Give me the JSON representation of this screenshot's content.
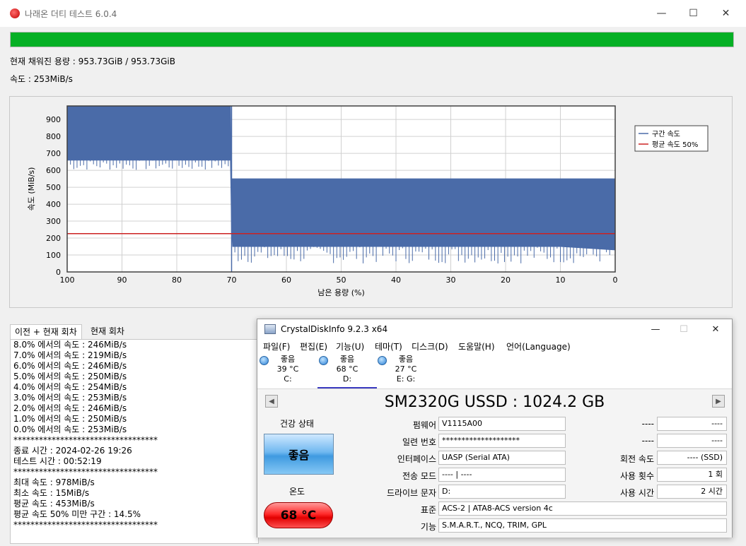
{
  "main_window": {
    "title": "나래온 더티 테스트 6.0.4",
    "progress_percent": 100,
    "filled_label": "현재 채워진 용량 : 953.73GiB / 953.73GiB",
    "speed_label": "속도 : 253MiB/s",
    "minimize_icon": "minimize-icon",
    "maximize_icon": "maximize-icon",
    "close_icon": "close-icon"
  },
  "chart_data": {
    "type": "area",
    "xlabel": "남은 용량 (%)",
    "ylabel": "속도 (MiB/s)",
    "xlim": [
      100,
      0
    ],
    "ylim": [
      0,
      980
    ],
    "x_ticks": [
      "100",
      "90",
      "80",
      "70",
      "60",
      "50",
      "40",
      "30",
      "20",
      "10",
      "0"
    ],
    "y_ticks": [
      "0",
      "100",
      "200",
      "300",
      "400",
      "500",
      "600",
      "700",
      "800",
      "900"
    ],
    "grid": true,
    "legend_position": "top-right",
    "series": [
      {
        "name": "구간 속도",
        "color": "#4a6ba8",
        "x": [
          100,
          90,
          80,
          70.2,
          70,
          69.8,
          60,
          50,
          40,
          30,
          20,
          10,
          0
        ],
        "upper": [
          978,
          978,
          978,
          978,
          550,
          550,
          550,
          550,
          550,
          550,
          550,
          550,
          550
        ],
        "lower": [
          660,
          660,
          660,
          660,
          240,
          150,
          150,
          150,
          150,
          150,
          150,
          150,
          130
        ]
      },
      {
        "name": "평균 속도 50%",
        "color": "#cc2222",
        "x": [
          100,
          0
        ],
        "values": [
          226,
          226
        ]
      }
    ]
  },
  "log_tabs": {
    "prev": "이전 + 현재 회차",
    "current": "현재 회차"
  },
  "log_lines": [
    "8.0% 에서의 속도 : 246MiB/s",
    "7.0% 에서의 속도 : 219MiB/s",
    "6.0% 에서의 속도 : 246MiB/s",
    "5.0% 에서의 속도 : 250MiB/s",
    "4.0% 에서의 속도 : 254MiB/s",
    "3.0% 에서의 속도 : 253MiB/s",
    "2.0% 에서의 속도 : 246MiB/s",
    "1.0% 에서의 속도 : 250MiB/s",
    "0.0% 에서의 속도 : 253MiB/s",
    "**********************************",
    "종료 시간 : 2024-02-26 19:26",
    "테스트 시간 : 00:52:19",
    "**********************************",
    "최대 속도 : 978MiB/s",
    "최소 속도 : 15MiB/s",
    "평균 속도 : 453MiB/s",
    "평균 속도 50% 미만 구간 : 14.5%",
    "**********************************"
  ],
  "cdi": {
    "title": "CrystalDiskInfo 9.2.3 x64",
    "menu": [
      "파일(F)",
      "편집(E)",
      "기능(U)",
      "테마(T)",
      "디스크(D)",
      "도움말(H)",
      "언어(Language)"
    ],
    "drives": [
      {
        "status": "좋음",
        "temp": "39 °C",
        "letter": "C:"
      },
      {
        "status": "좋음",
        "temp": "68 °C",
        "letter": "D:"
      },
      {
        "status": "좋음",
        "temp": "27 °C",
        "letter": "E: G:"
      }
    ],
    "model": "SM2320G USSD : 1024.2 GB",
    "health_label": "건강 상태",
    "health_value": "좋음",
    "temp_label": "온도",
    "temp_value": "68 °C",
    "fields": {
      "firmware_label": "펌웨어",
      "firmware": "V1115A00",
      "serial_label": "일련 번호",
      "serial": "********************",
      "interface_label": "인터페이스",
      "interface": "UASP (Serial ATA)",
      "transfer_label": "전송 모드",
      "transfer": "---- | ----",
      "letter_label": "드라이브 문자",
      "letter": "D:",
      "standard_label": "표준",
      "standard": "ACS-2 | ATA8-ACS version 4c",
      "features_label": "기능",
      "features": "S.M.A.R.T., NCQ, TRIM, GPL",
      "r1_label": "----",
      "r1": "----",
      "r2_label": "----",
      "r2": "----",
      "rotation_label": "회전 속도",
      "rotation": "---- (SSD)",
      "count_label": "사용 횟수",
      "count": "1 회",
      "hours_label": "사용 시간",
      "hours": "2 시간"
    }
  }
}
